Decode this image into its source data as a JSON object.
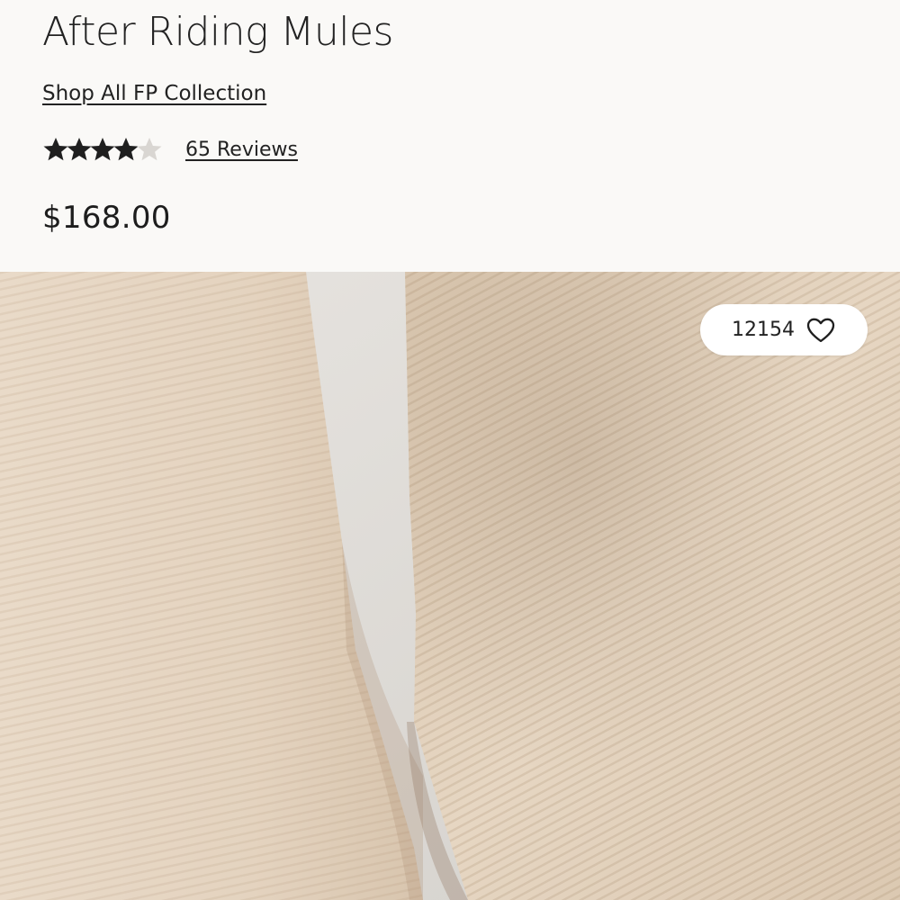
{
  "product": {
    "title": "After Riding Mules",
    "collection_link": "Shop All FP Collection",
    "rating": 4,
    "rating_max": 5,
    "reviews_link": "65 Reviews",
    "price": "$168.00"
  },
  "wishlist": {
    "count": "12154",
    "icon": "heart-outline-icon"
  },
  "colors": {
    "background": "#faf9f7",
    "text": "#222222",
    "star_filled": "#1f1f1f",
    "star_empty": "#d9d6d2",
    "fabric": "#e3d3bf"
  }
}
